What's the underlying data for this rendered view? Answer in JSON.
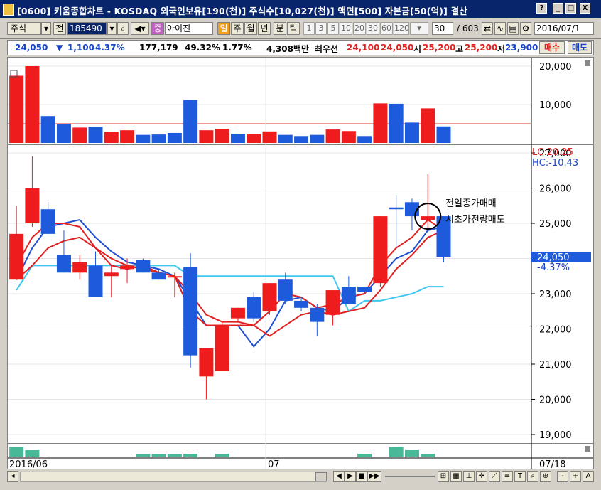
{
  "window": {
    "title": "[0600] 키움종합차트 - KOSDAQ 외국인보유[190(천)] 주식수[10,027(천)] 액면[500] 자본금[50(억)] 결산",
    "controls": [
      "?",
      "_",
      "□",
      "X"
    ]
  },
  "toolbar": {
    "market_label": "주식",
    "prev_label": "전",
    "stock_code": "185490",
    "stock_name": "아이진",
    "stock_type_badge": "중",
    "periods": [
      "일",
      "주",
      "월",
      "년",
      "분",
      "틱"
    ],
    "minute_options": [
      "1",
      "3",
      "5",
      "10",
      "20",
      "30",
      "60",
      "120"
    ],
    "count_value": "30",
    "count_total": "/ 603",
    "date": "2016/07/1"
  },
  "infobar": {
    "price": "24,050",
    "change_arrow": "▼",
    "change": "1,100",
    "change_pct": "-4.37%",
    "volume": "177,179",
    "volume_ratio": "49.32%",
    "turnover": "1.77%",
    "amount": "4,308백만",
    "best_bid_label": "최우선",
    "best_bid": "24,100",
    "best_ask": "24,050",
    "open_label": "시",
    "open": "25,200",
    "high_label": "고",
    "high": "25,200",
    "low_label": "저",
    "low": "23,900",
    "buy_button": "매수",
    "sell_button": "매도"
  },
  "chart_data": [
    {
      "type": "bar",
      "panel": "volume",
      "yticks": [
        "20,000",
        "10,000"
      ],
      "ylim": [
        0,
        20000
      ],
      "reference_line": 5000,
      "categories": [
        "1",
        "2",
        "3",
        "4",
        "5",
        "6",
        "7",
        "8",
        "9",
        "10",
        "11",
        "12",
        "13",
        "14",
        "15",
        "16",
        "17",
        "18",
        "19",
        "20",
        "21",
        "22",
        "23",
        "24",
        "25",
        "26",
        "27",
        "28",
        "29",
        "30"
      ],
      "values": [
        17500,
        20000,
        7000,
        5000,
        4000,
        4200,
        2900,
        3300,
        2100,
        2200,
        2600,
        11200,
        3300,
        3700,
        2400,
        2400,
        3000,
        2100,
        1800,
        2100,
        3500,
        3100,
        1800,
        10300,
        10200,
        5300,
        9000,
        4300,
        0,
        0
      ],
      "colors": [
        "red",
        "red",
        "blue",
        "blue",
        "red",
        "blue",
        "red",
        "red",
        "blue",
        "blue",
        "blue",
        "blue",
        "red",
        "red",
        "blue",
        "red",
        "red",
        "blue",
        "blue",
        "blue",
        "red",
        "red",
        "blue",
        "red",
        "blue",
        "blue",
        "red",
        "blue",
        null,
        null
      ]
    },
    {
      "type": "candlestick",
      "panel": "price",
      "ylim": [
        19000,
        27000
      ],
      "yticks": [
        "27,000",
        "26,000",
        "25,000",
        "24,000",
        "23,000",
        "22,000",
        "21,000",
        "20,000",
        "19,000"
      ],
      "current_price_label": "24,050",
      "current_change_label": "-4.37%",
      "lc_label": "LC:20.25",
      "hc_label": "HC:-10.43",
      "xlabels": [
        "2016/06",
        "07",
        "07/18"
      ],
      "annotation": [
        "전일종가매매",
        "시초가전량매도"
      ],
      "candles": [
        {
          "o": 24700,
          "h": 25500,
          "l": 23400,
          "c": 23400,
          "color": "red"
        },
        {
          "o": 25000,
          "h": 26900,
          "l": 24900,
          "c": 26000,
          "color": "red"
        },
        {
          "o": 25400,
          "h": 25600,
          "l": 24700,
          "c": 24700,
          "color": "blue"
        },
        {
          "o": 24100,
          "h": 24800,
          "l": 23600,
          "c": 23600,
          "color": "blue"
        },
        {
          "o": 23600,
          "h": 24100,
          "l": 23400,
          "c": 23900,
          "color": "red"
        },
        {
          "o": 23800,
          "h": 24200,
          "l": 22900,
          "c": 22900,
          "color": "blue"
        },
        {
          "o": 23500,
          "h": 23800,
          "l": 22900,
          "c": 23600,
          "color": "red"
        },
        {
          "o": 23700,
          "h": 24000,
          "l": 23300,
          "c": 23800,
          "color": "red"
        },
        {
          "o": 23950,
          "h": 24000,
          "l": 23600,
          "c": 23600,
          "color": "blue"
        },
        {
          "o": 23600,
          "h": 23700,
          "l": 23400,
          "c": 23400,
          "color": "blue"
        },
        {
          "o": 23500,
          "h": 23600,
          "l": 22900,
          "c": 23500,
          "color": "red"
        },
        {
          "o": 23750,
          "h": 24150,
          "l": 20900,
          "c": 21250,
          "color": "blue"
        },
        {
          "o": 20650,
          "h": 21400,
          "l": 20000,
          "c": 21450,
          "color": "red"
        },
        {
          "o": 20800,
          "h": 22200,
          "l": 20800,
          "c": 22100,
          "color": "red"
        },
        {
          "o": 22300,
          "h": 22600,
          "l": 22200,
          "c": 22600,
          "color": "red"
        },
        {
          "o": 22900,
          "h": 23050,
          "l": 22200,
          "c": 22300,
          "color": "blue"
        },
        {
          "o": 22500,
          "h": 23300,
          "l": 22400,
          "c": 23300,
          "color": "red"
        },
        {
          "o": 23400,
          "h": 23600,
          "l": 22700,
          "c": 22800,
          "color": "blue"
        },
        {
          "o": 22800,
          "h": 22900,
          "l": 22500,
          "c": 22600,
          "color": "blue"
        },
        {
          "o": 22600,
          "h": 22700,
          "l": 21800,
          "c": 22200,
          "color": "blue"
        },
        {
          "o": 22400,
          "h": 23000,
          "l": 22100,
          "c": 23100,
          "color": "red"
        },
        {
          "o": 23200,
          "h": 23500,
          "l": 22700,
          "c": 22700,
          "color": "blue"
        },
        {
          "o": 23200,
          "h": 23200,
          "l": 23050,
          "c": 23050,
          "color": "blue"
        },
        {
          "o": 23300,
          "h": 25200,
          "l": 23200,
          "c": 25200,
          "color": "red"
        },
        {
          "o": 25450,
          "h": 25800,
          "l": 24300,
          "c": 25400,
          "color": "blue"
        },
        {
          "o": 25600,
          "h": 25700,
          "l": 24800,
          "c": 25200,
          "color": "blue"
        },
        {
          "o": 25100,
          "h": 26400,
          "l": 24800,
          "c": 25200,
          "color": "red"
        },
        {
          "o": 25200,
          "h": 25200,
          "l": 23900,
          "c": 24050,
          "color": "blue"
        },
        null,
        null
      ],
      "ma_short": [
        23800,
        24600,
        25000,
        25000,
        24900,
        24300,
        23800,
        23700,
        23800,
        23600,
        23500,
        22500,
        22100,
        22100,
        22100,
        22100,
        22500,
        23000,
        22900,
        22600,
        22700,
        22900,
        23000,
        23800,
        24300,
        24600,
        25100,
        24800,
        null,
        null
      ],
      "ma_mid": [
        23400,
        24300,
        24900,
        25000,
        25100,
        24600,
        24200,
        23900,
        23800,
        23700,
        23500,
        22800,
        22100,
        22100,
        22100,
        21500,
        22000,
        22800,
        22900,
        22600,
        22500,
        22900,
        23000,
        23500,
        24000,
        24200,
        24800,
        24900,
        null,
        null
      ],
      "ma_long": [
        23400,
        23800,
        24300,
        24500,
        24600,
        24300,
        24000,
        23800,
        23700,
        23600,
        23500,
        23000,
        22400,
        22200,
        22200,
        22100,
        21800,
        22100,
        22400,
        22500,
        22400,
        22500,
        22600,
        23100,
        23700,
        24100,
        24600,
        24800,
        null,
        null
      ],
      "ma_base": [
        23100,
        23800,
        23800,
        23800,
        23800,
        23800,
        23800,
        23800,
        23800,
        23800,
        23800,
        23500,
        23500,
        23500,
        23500,
        23500,
        23500,
        23500,
        23500,
        23500,
        23500,
        22500,
        22800,
        22800,
        22900,
        23000,
        23200,
        23200,
        null,
        null
      ]
    },
    {
      "type": "bar",
      "panel": "sub-indicator",
      "values": [
        3,
        2,
        0,
        0,
        0,
        0,
        0,
        0,
        1,
        1,
        1,
        1,
        0,
        1,
        0,
        0,
        0,
        0,
        0,
        0,
        0,
        0,
        1,
        0,
        3,
        2,
        1,
        0,
        0,
        0
      ]
    }
  ],
  "bottombar": {
    "nav_buttons": [
      "◀",
      "▶",
      "■",
      "▶▶"
    ],
    "zoom": [
      "-",
      "+",
      "A"
    ]
  }
}
